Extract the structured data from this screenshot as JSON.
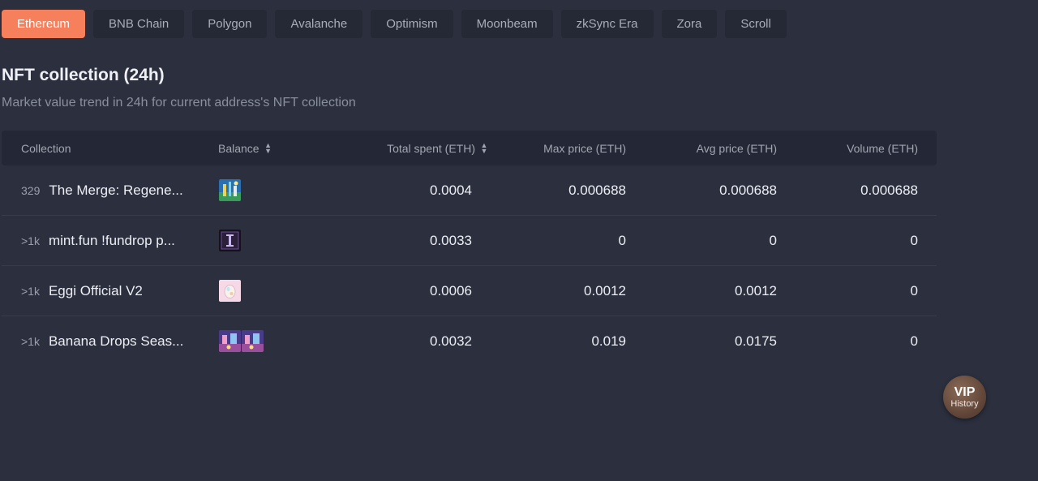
{
  "chain_tabs": [
    {
      "label": "Ethereum",
      "active": true
    },
    {
      "label": "BNB Chain",
      "active": false
    },
    {
      "label": "Polygon",
      "active": false
    },
    {
      "label": "Avalanche",
      "active": false
    },
    {
      "label": "Optimism",
      "active": false
    },
    {
      "label": "Moonbeam",
      "active": false
    },
    {
      "label": "zkSync Era",
      "active": false
    },
    {
      "label": "Zora",
      "active": false
    },
    {
      "label": "Scroll",
      "active": false
    }
  ],
  "section": {
    "title": "NFT collection (24h)",
    "subtitle": "Market value trend in 24h for current address's NFT collection"
  },
  "table": {
    "headers": {
      "collection": "Collection",
      "balance": "Balance",
      "total_spent": "Total spent (ETH)",
      "max_price": "Max price (ETH)",
      "avg_price": "Avg price (ETH)",
      "volume": "Volume (ETH)"
    },
    "sort_icon": "sort-updown-icon",
    "rows": [
      {
        "count": "329",
        "name": "The Merge: Regene...",
        "thumbs": [
          "merge-art-icon"
        ],
        "total_spent": "0.0004",
        "max_price": "0.000688",
        "avg_price": "0.000688",
        "volume": "0.000688"
      },
      {
        "count": ">1k",
        "name": "mint.fun !fundrop p...",
        "thumbs": [
          "fundrop-pass-icon"
        ],
        "total_spent": "0.0033",
        "max_price": "0",
        "avg_price": "0",
        "volume": "0"
      },
      {
        "count": ">1k",
        "name": "Eggi Official V2",
        "thumbs": [
          "egg-icon"
        ],
        "total_spent": "0.0006",
        "max_price": "0.0012",
        "avg_price": "0.0012",
        "volume": "0"
      },
      {
        "count": ">1k",
        "name": "Banana Drops Seas...",
        "thumbs": [
          "banana-drop-icon",
          "banana-drop-icon"
        ],
        "total_spent": "0.0032",
        "max_price": "0.019",
        "avg_price": "0.0175",
        "volume": "0"
      }
    ]
  },
  "vip_button": {
    "title": "VIP",
    "subtitle": "History"
  },
  "colors": {
    "background": "#2c303e",
    "tab_active": "#f7805c",
    "tab_inactive": "#252936",
    "table_header": "#242836"
  }
}
